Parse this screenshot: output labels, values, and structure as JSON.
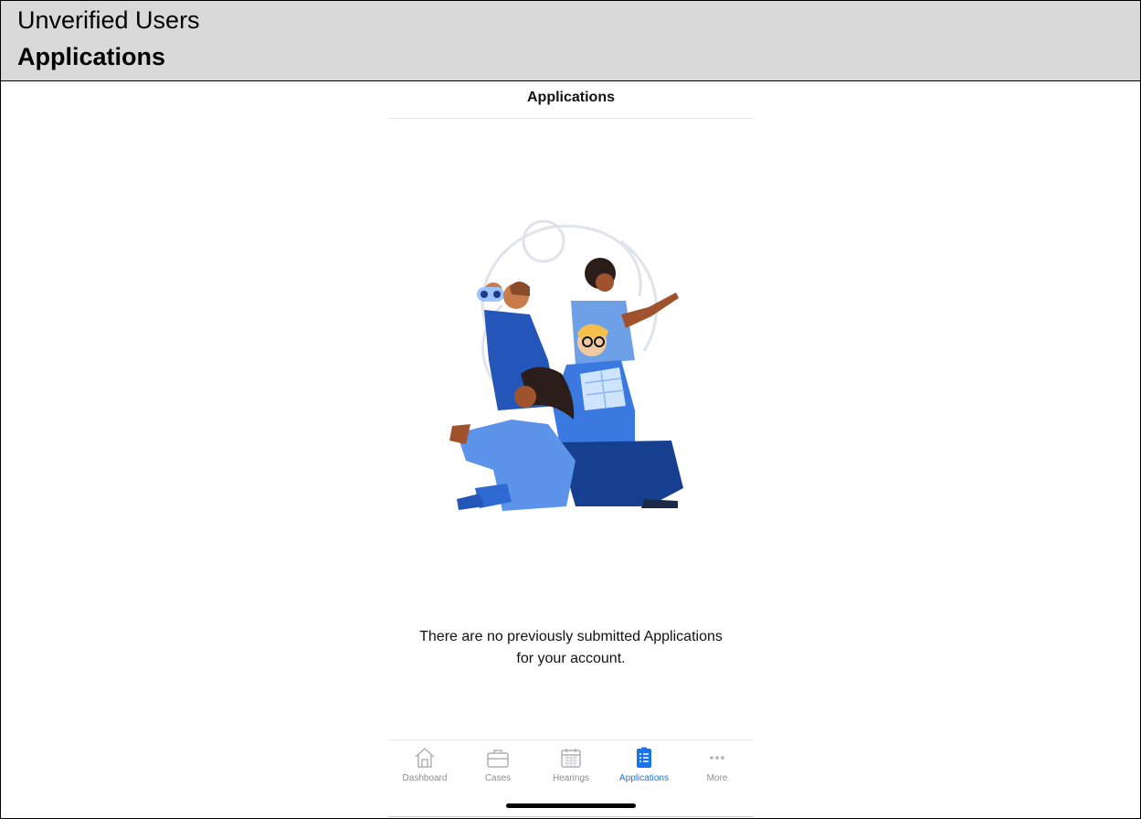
{
  "document": {
    "subtitle": "Unverified Users",
    "title": "Applications"
  },
  "screen": {
    "title": "Applications",
    "empty_message_line1": "There are no previously submitted Applications",
    "empty_message_line2": "for your account."
  },
  "tabbar": {
    "items": [
      {
        "label": "Dashboard",
        "icon": "house-icon",
        "active": false
      },
      {
        "label": "Cases",
        "icon": "briefcase-icon",
        "active": false
      },
      {
        "label": "Hearings",
        "icon": "calendar-icon",
        "active": false
      },
      {
        "label": "Applications",
        "icon": "clipboard-icon",
        "active": true
      },
      {
        "label": "More",
        "icon": "ellipsis-icon",
        "active": false
      }
    ]
  },
  "colors": {
    "header_bg": "#d9d9d9",
    "accent": "#1a73e8",
    "inactive": "#8e8e93"
  }
}
